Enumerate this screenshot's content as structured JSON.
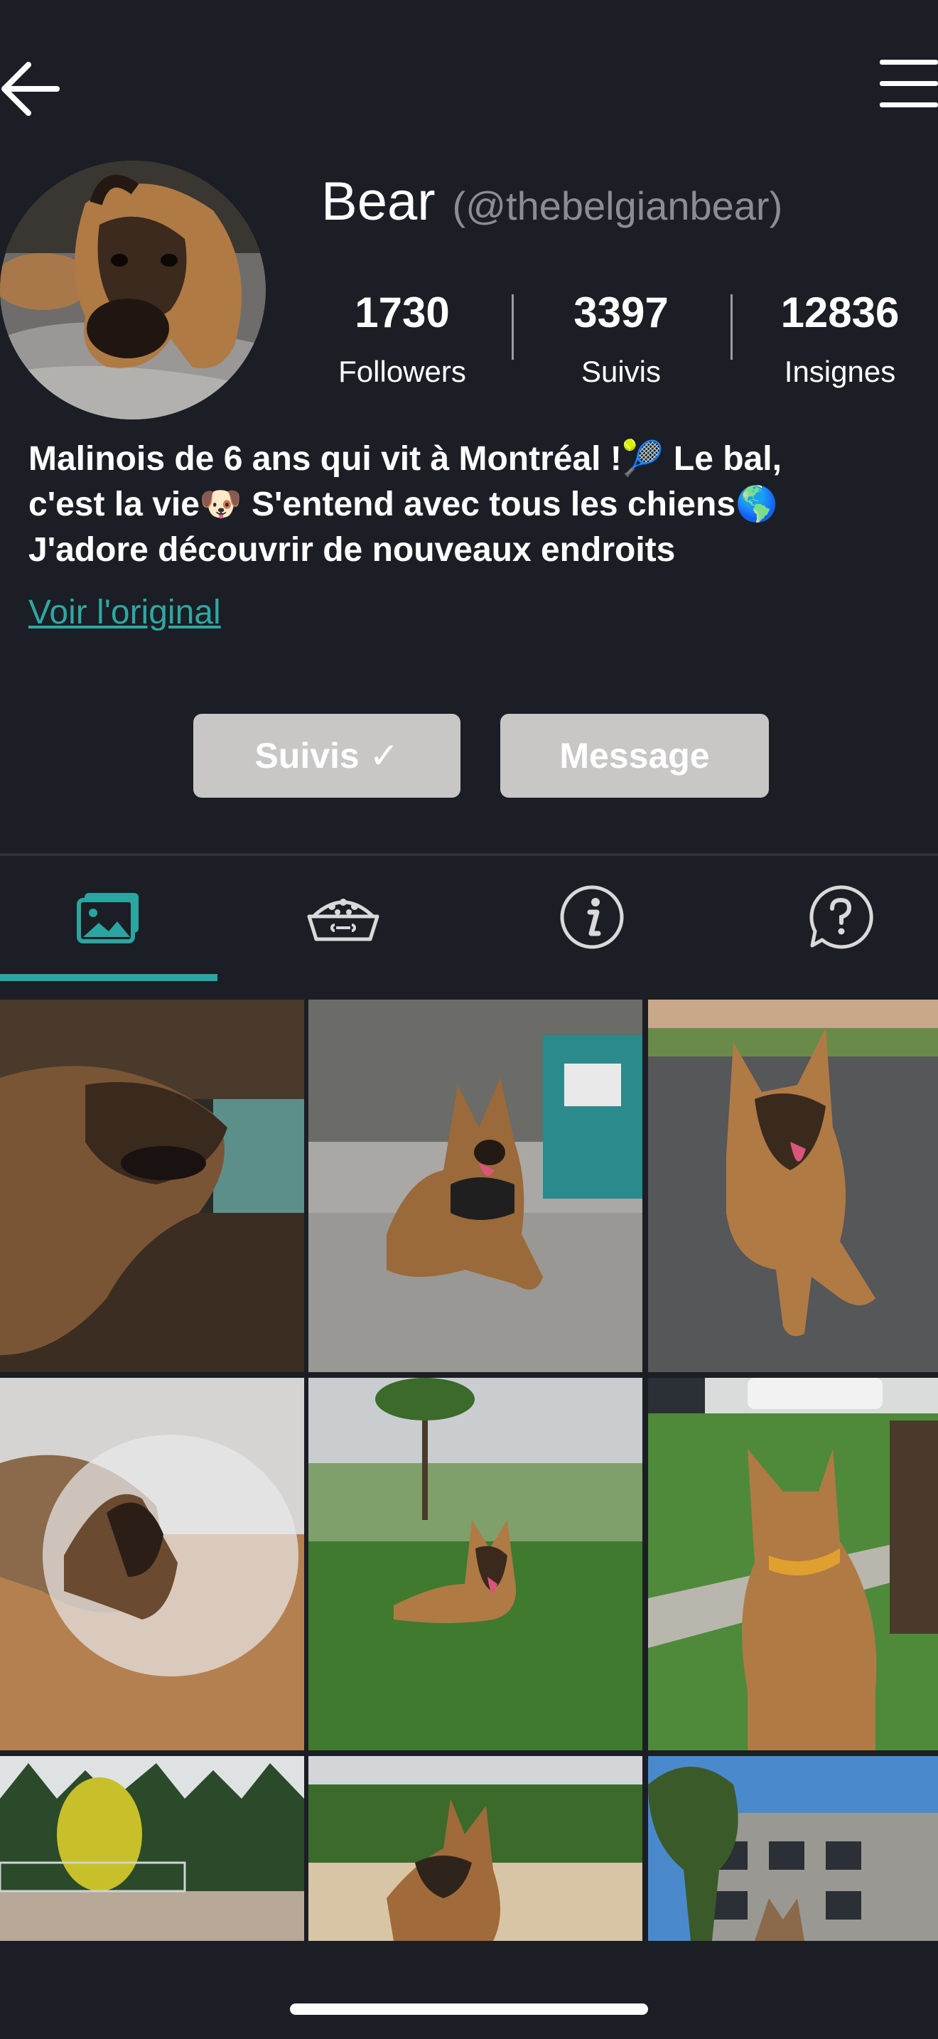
{
  "header": {
    "back_icon": "arrow-left-icon",
    "menu_icon": "hamburger-menu-icon"
  },
  "profile": {
    "display_name": "Bear",
    "handle": "(@thebelgianbear)",
    "avatar_icon": "dog-avatar-photo",
    "stats": [
      {
        "value": "1730",
        "label": "Followers"
      },
      {
        "value": "3397",
        "label": "Suivis"
      },
      {
        "value": "12836",
        "label": "Insignes"
      }
    ],
    "bio": " Malinois de 6 ans qui vit à Montréal !🎾 Le bal,\nc'est la vie🐶 S'entend avec tous les chiens🌎\nJ'adore découvrir de nouveaux endroits",
    "see_original": "Voir l'original"
  },
  "actions": {
    "follow_label": "Suivis ✓",
    "message_label": "Message"
  },
  "tabs": [
    {
      "icon": "photos-icon",
      "active": true
    },
    {
      "icon": "dog-food-bowl-icon",
      "active": false
    },
    {
      "icon": "info-icon",
      "active": false
    },
    {
      "icon": "question-bubble-icon",
      "active": false
    }
  ],
  "colors": {
    "background": "#1b1e24",
    "accent": "#2aa5a2",
    "button_bg": "#c9c6c6",
    "muted_text": "#8a8d92"
  }
}
